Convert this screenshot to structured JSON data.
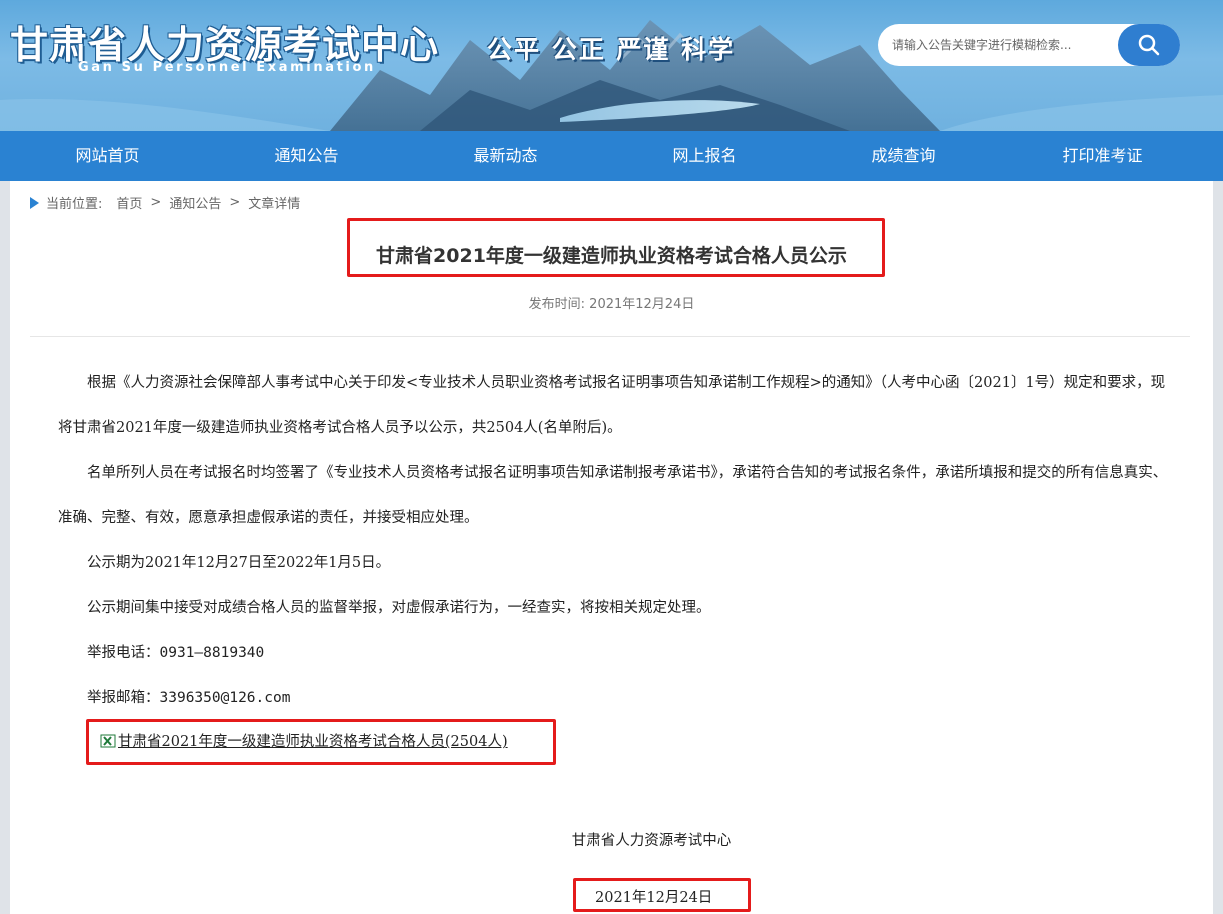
{
  "header": {
    "logo_cn": "甘肃省人力资源考试中心",
    "logo_en": "Gan Su Personnel Examination",
    "slogan": "公平 公正 严谨 科学",
    "search_placeholder": "请输入公告关键字进行模糊检索..."
  },
  "nav": {
    "items": [
      "网站首页",
      "通知公告",
      "最新动态",
      "网上报名",
      "成绩查询",
      "打印准考证"
    ]
  },
  "breadcrumb": {
    "prefix": "当前位置:",
    "items": [
      "首页",
      "通知公告",
      "文章详情"
    ],
    "separator": ">"
  },
  "article": {
    "title": "甘肃省2021年度一级建造师执业资格考试合格人员公示",
    "published": "发布时间: 2021年12月24日",
    "paragraphs": [
      "根据《人力资源社会保障部人事考试中心关于印发<专业技术人员职业资格考试报名证明事项告知承诺制工作规程>的通知》（人考中心函〔2021〕1号）规定和要求，现将甘肃省2021年度一级建造师执业资格考试合格人员予以公示，共2504人(名单附后)。",
      "名单所列人员在考试报名时均签署了《专业技术人员资格考试报名证明事项告知承诺制报考承诺书》，承诺符合告知的考试报名条件，承诺所填报和提交的所有信息真实、准确、完整、有效，愿意承担虚假承诺的责任，并接受相应处理。",
      "公示期为2021年12月27日至2022年1月5日。",
      "公示期间集中接受对成绩合格人员的监督举报，对虚假承诺行为，一经查实，将按相关规定处理。"
    ],
    "phone_label": "举报电话：",
    "phone": "0931—8819340",
    "email_label": "举报邮箱：",
    "email": "3396350@126.com",
    "attachment": "甘肃省2021年度一级建造师执业资格考试合格人员(2504人)",
    "attachment_icon": "excel-file-icon",
    "signature": "甘肃省人力资源考试中心",
    "signature_date": "2021年12月24日"
  },
  "colors": {
    "nav_bg": "#2a82d2",
    "highlight_border": "#e41b1b",
    "search_button": "#2f7ed0"
  }
}
